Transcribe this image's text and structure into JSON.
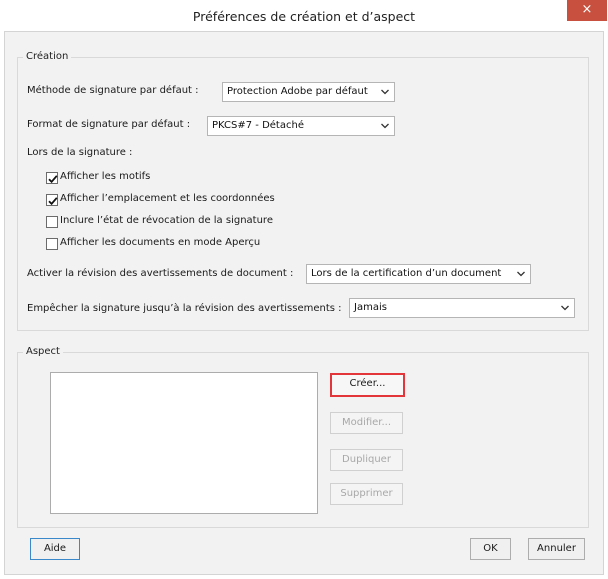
{
  "window": {
    "title": "Préférences de création et d’aspect",
    "close_glyph": "×"
  },
  "creation": {
    "group_label": "Création",
    "method_label": "Méthode de signature par défaut :",
    "method_value": "Protection Adobe par défaut",
    "format_label": "Format de signature par défaut :",
    "format_value": "PKCS#7 - Détaché",
    "when_signing_label": "Lors de la signature :",
    "checkboxes": [
      {
        "label": "Afficher les motifs",
        "checked": true
      },
      {
        "label": "Afficher l’emplacement et les coordonnées",
        "checked": true
      },
      {
        "label": "Inclure l’état de révocation de la signature",
        "checked": false
      },
      {
        "label": "Afficher les documents en mode Aperçu",
        "checked": false
      }
    ],
    "warnings_review_label": "Activer la révision des avertissements de document :",
    "warnings_review_value": "Lors de la certification d’un document",
    "prevent_signing_label": "Empêcher la signature jusqu’à la révision des avertissements :",
    "prevent_signing_value": "Jamais"
  },
  "appearance": {
    "group_label": "Aspect",
    "buttons": {
      "create": "Créer...",
      "modify": "Modifier...",
      "duplicate": "Dupliquer",
      "delete": "Supprimer"
    }
  },
  "footer": {
    "help": "Aide",
    "ok": "OK",
    "cancel": "Annuler"
  },
  "colors": {
    "close_button": "#c7503e",
    "highlight_border": "#e2363b",
    "dialog_background": "#f2f2f2"
  }
}
